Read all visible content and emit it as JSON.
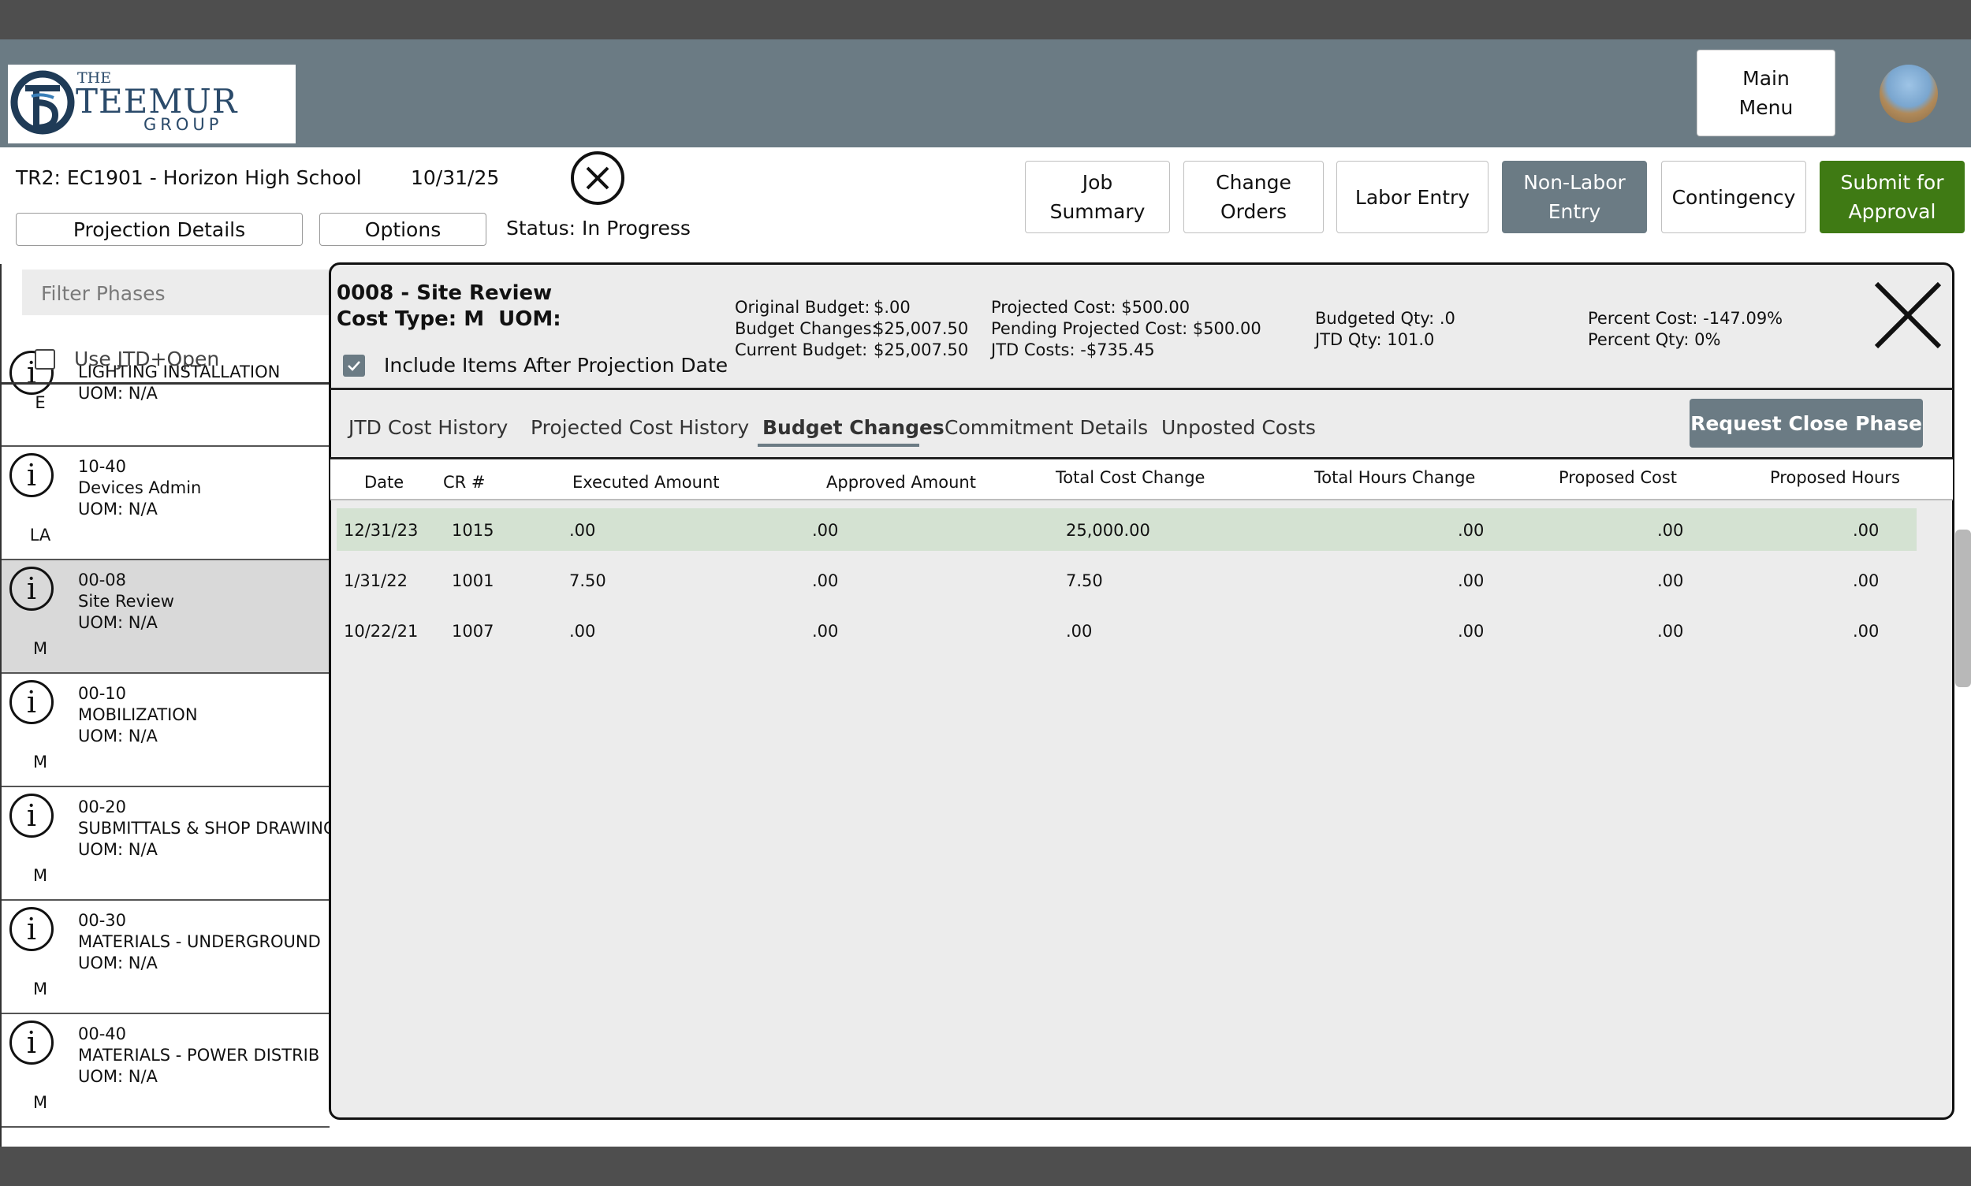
{
  "header": {
    "logo": {
      "small": "THE",
      "big": "TEEMUR",
      "sub": "GROUP"
    },
    "main_menu": "Main\nMenu",
    "job_title": "TR2: EC1901 - Horizon High School",
    "date": "10/31/25",
    "status": "Status: In Progress",
    "projection_details": "Projection Details",
    "options": "Options",
    "nav": {
      "job_summary": "Job\nSummary",
      "change_orders": "Change\nOrders",
      "labor_entry": "Labor Entry",
      "non_labor_entry": "Non-Labor\nEntry",
      "contingency": "Contingency",
      "submit": "Submit for\nApproval"
    },
    "colors": {
      "header_bg": "#6b7b84",
      "submit_bg": "#3f7a14",
      "active_bg": "#6b7b84",
      "selected_row": "#d4e2d2"
    }
  },
  "sidebar": {
    "filter_placeholder": "Filter Phases",
    "use_jtd": "Use JTD+Open",
    "partial": {
      "name": "LIGHTING INSTALLATION",
      "uom": "UOM: N/A",
      "type": "E"
    },
    "phases": [
      {
        "code": "10-40",
        "name": "Devices Admin",
        "uom": "UOM: N/A",
        "type": "LA"
      },
      {
        "code": "00-08",
        "name": "Site Review",
        "uom": "UOM: N/A",
        "type": "M"
      },
      {
        "code": "00-10",
        "name": "MOBILIZATION",
        "uom": "UOM: N/A",
        "type": "M"
      },
      {
        "code": "00-20",
        "name": "SUBMITTALS & SHOP DRAWING",
        "uom": "UOM: N/A",
        "type": "M"
      },
      {
        "code": "00-30",
        "name": "MATERIALS - UNDERGROUND",
        "uom": "UOM: N/A",
        "type": "M"
      },
      {
        "code": "00-40",
        "name": "MATERIALS - POWER DISTRIB",
        "uom": "UOM: N/A",
        "type": "M"
      }
    ]
  },
  "panel": {
    "title": "0008 - Site Review",
    "cost_type": "Cost Type: M  UOM:",
    "include_items": "Include Items After Projection Date",
    "original_budget_label": "Original Budget:",
    "original_budget": "$.00",
    "budget_changes_label": "Budget Changes:",
    "budget_changes": "$25,007.50",
    "current_budget_label": "Current Budget:",
    "current_budget": "$25,007.50",
    "projected_cost": "Projected Cost: $500.00",
    "pending_projected": "Pending Projected Cost: $500.00",
    "jtd_costs": "JTD Costs: -$735.45",
    "budgeted_qty": "Budgeted Qty: .0",
    "jtd_qty": "JTD Qty: 101.0",
    "percent_cost": "Percent Cost: -147.09%",
    "percent_qty": "Percent Qty: 0%",
    "tabs": [
      "JTD Cost History",
      "Projected Cost History",
      "Budget Changes",
      "Commitment Details",
      "Unposted Costs"
    ],
    "request_close": "Request Close Phase",
    "columns": [
      "Date",
      "CR #",
      "Executed Amount",
      "Approved Amount",
      "Total Cost Change",
      "Total Hours Change",
      "Proposed Cost",
      "Proposed Hours"
    ],
    "rows": [
      [
        "12/31/23",
        "1015",
        ".00",
        ".00",
        "25,000.00",
        ".00",
        ".00",
        ".00"
      ],
      [
        "1/31/22",
        "1001",
        "7.50",
        ".00",
        "7.50",
        ".00",
        ".00",
        ".00"
      ],
      [
        "10/22/21",
        "1007",
        ".00",
        ".00",
        ".00",
        ".00",
        ".00",
        ".00"
      ]
    ]
  }
}
